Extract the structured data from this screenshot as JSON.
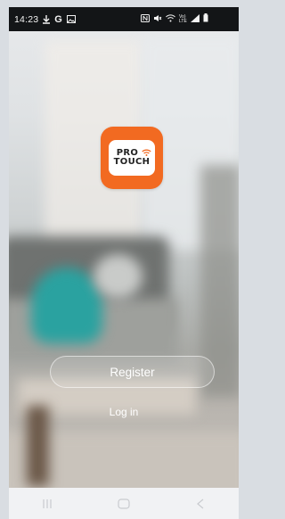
{
  "status_bar": {
    "time": "14:23",
    "left_icons": [
      "download-icon",
      "google-icon",
      "gallery-icon"
    ],
    "right_icons": [
      "nfc-icon",
      "mute-icon",
      "wifi-icon",
      "volte-icon",
      "signal-icon",
      "battery-icon"
    ],
    "volte_text": "Vo)\nLTE"
  },
  "logo": {
    "line1": "PRO",
    "line2": "TOUCH",
    "color": "#f26a21"
  },
  "actions": {
    "register_label": "Register",
    "login_label": "Log in"
  },
  "nav_bar": {
    "icons": [
      "recents-icon",
      "home-icon",
      "back-icon"
    ]
  }
}
